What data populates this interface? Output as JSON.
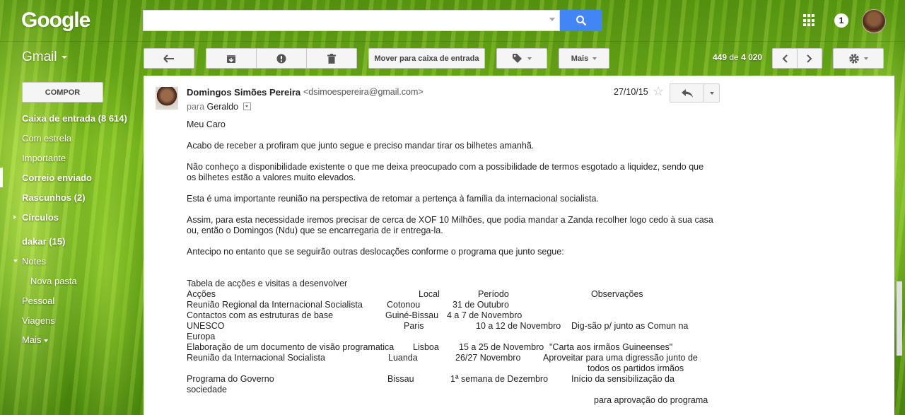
{
  "header": {
    "logo": "Google",
    "search": {
      "value": "",
      "placeholder": ""
    },
    "notifications": "1"
  },
  "toolbar": {
    "app_label": "Gmail",
    "move_to_inbox": "Mover para caixa de entrada",
    "more": "Mais",
    "pager": {
      "range": "449",
      "of": "de",
      "total": "4 020"
    }
  },
  "sidebar": {
    "compose": "COMPOR",
    "items": [
      {
        "label": "Caixa de entrada (8 614)"
      },
      {
        "label": "Com estrela"
      },
      {
        "label": "Importante"
      },
      {
        "label": "Correio enviado"
      },
      {
        "label": "Rascunhos (2)"
      },
      {
        "label": "Círculos"
      },
      {
        "label": "dakar (15)"
      },
      {
        "label": "Notes"
      },
      {
        "label": "Nova pasta"
      },
      {
        "label": "Pessoal"
      },
      {
        "label": "Viagens"
      },
      {
        "label": "Mais"
      }
    ]
  },
  "message": {
    "sender_name": "Domingos Simões Pereira",
    "sender_email": "<dsimoespereira@gmail.com>",
    "to_prefix": "para",
    "to_name": "Geraldo",
    "date": "27/10/15",
    "body": [
      "Meu Caro",
      "Acabo de receber a profiram que junto segue e preciso mandar tirar os bilhetes amanhã.",
      "Não conheço a disponibilidade existente o que me deixa preocupado com a possibilidade de termos esgotado a liquidez, sendo que os bilhetes estão a valores muito elevados.",
      "Esta é uma importante reunião na perspectiva de retomar a pertença à família da internacional socialista.",
      "Assim, para esta necessidade iremos precisar de cerca de XOF 10 Milhões, que podia mandar a Zanda recolher logo cedo à sua casa ou, então o Domingos (Ndu) que se encarregaria de ir entrega-la.",
      "Antecipo no entanto que se seguirão outras deslocações conforme o programa que junto segue:"
    ],
    "table": {
      "title": "Tabela de acções e visitas a desenvolver",
      "headers": [
        "Acções",
        "Local",
        "Período",
        "Observações"
      ],
      "rows": [
        [
          "Reunião Regional da Internacional Socialista",
          "Cotonou",
          "31 de Outubro",
          ""
        ],
        [
          "Contactos com as estruturas de base",
          "Guiné-Bissau",
          "4 a 7 de Novembro",
          ""
        ],
        [
          "UNESCO",
          "Paris",
          "10 a 12 de Novembro",
          "Dig-são p/ junto as Comun na"
        ],
        [
          "Europa",
          "",
          "",
          ""
        ],
        [
          "Elaboração de um documento de visão programatica",
          "Lisboa",
          "15 a 25 de Novembro",
          "\"Carta aos irmãos Guineenses\""
        ],
        [
          "Reunião da Internacional Socialista",
          "Luanda",
          "26/27 Novembro",
          "Aproveitar para uma digressão junto de"
        ],
        [
          "",
          "",
          "",
          "todos os partidos irmãos"
        ],
        [
          "Programa do Governo",
          "Bissau",
          "1ª semana de Dezembro",
          "Início da sensibilização da"
        ],
        [
          "sociedade",
          "",
          "",
          ""
        ],
        [
          "",
          "",
          "",
          "para aprovação do programa"
        ]
      ]
    }
  }
}
